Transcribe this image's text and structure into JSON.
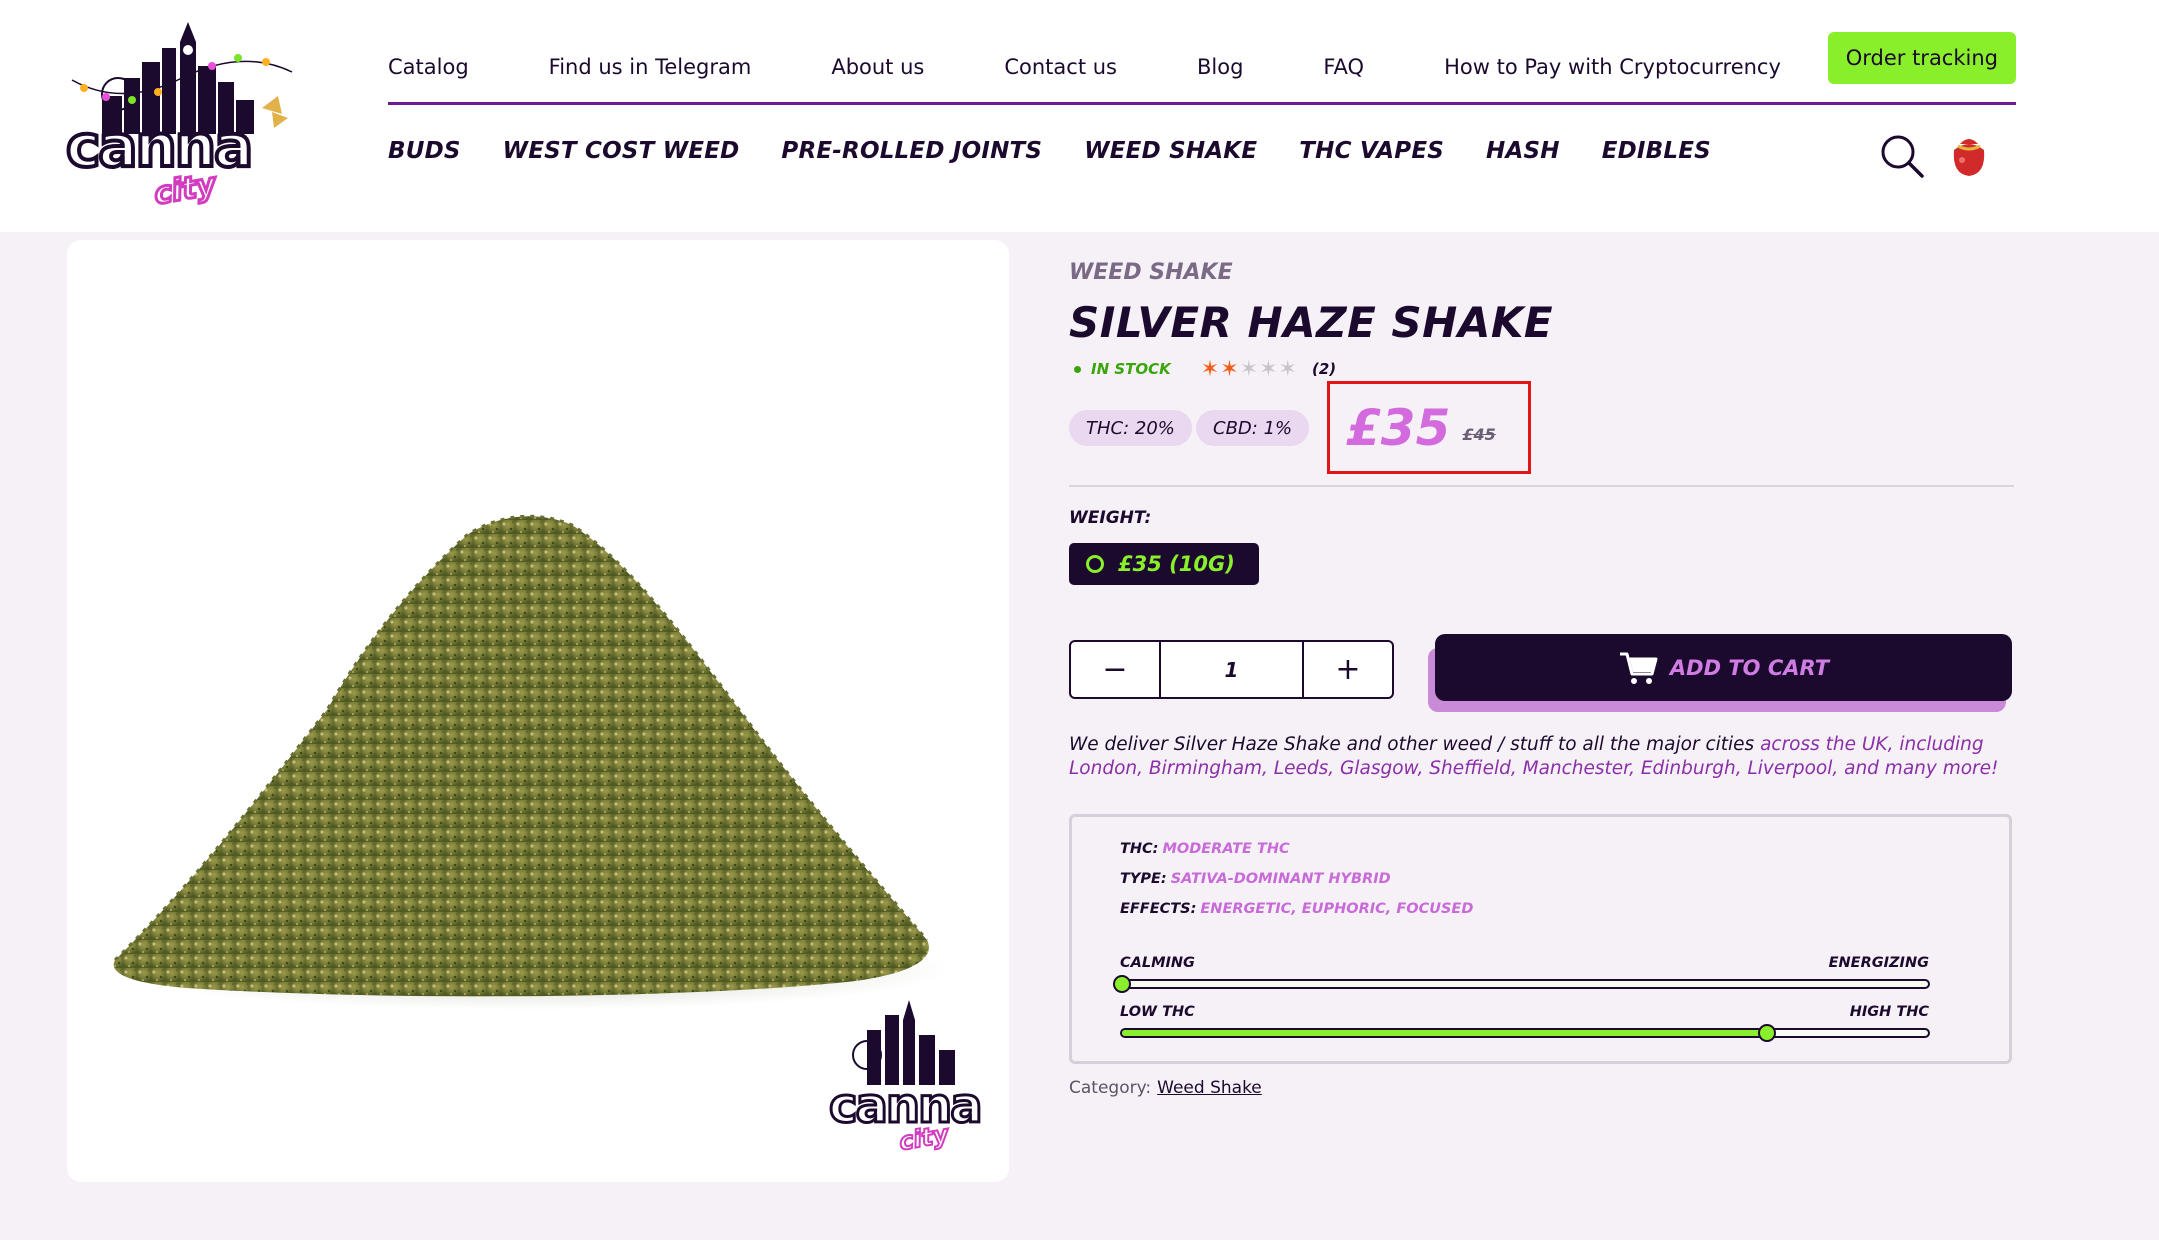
{
  "header": {
    "logo_main": "canna",
    "logo_sub": "city",
    "top_links": [
      "Catalog",
      "Find us in Telegram",
      "About us",
      "Contact us",
      "Blog",
      "FAQ",
      "How to Pay with Cryptocurrency"
    ],
    "order_tracking": "Order tracking",
    "categories": [
      "BUDS",
      "WEST COST WEED",
      "PRE-ROLLED JOINTS",
      "WEED SHAKE",
      "THC VAPES",
      "HASH",
      "EDIBLES"
    ]
  },
  "product": {
    "category": "WEED SHAKE",
    "title": "SILVER HAZE SHAKE",
    "stock": "IN STOCK",
    "rating": 2,
    "rating_max": 5,
    "review_count": "(2)",
    "thc_pill": "THC: 20%",
    "cbd_pill": "CBD: 1%",
    "price": "£35",
    "old_price": "£45",
    "weight_label": "WEIGHT:",
    "weight_option": "£35 (10G)",
    "quantity": "1",
    "minus": "−",
    "plus": "+",
    "add_to_cart": "ADD TO CART",
    "delivery_text": "We deliver Silver Haze Shake and other weed / stuff to all the major cities",
    "delivery_highlight": "across the UK, including London, Birmingham, Leeds, Glasgow, Sheffield, Manchester, Edinburgh, Liverpool, and many more!",
    "specs": {
      "thc_label": "THC:",
      "thc_value": "MODERATE THC",
      "type_label": "TYPE:",
      "type_value": "SATIVA-DOMINANT HYBRID",
      "effects_label": "EFFECTS:",
      "effects_value": "ENERGETIC, EUPHORIC, FOCUSED",
      "scale1_left": "CALMING",
      "scale1_right": "ENERGIZING",
      "scale1_value": 0.0,
      "scale2_left": "LOW THC",
      "scale2_right": "HIGH THC",
      "scale2_value": 0.8
    },
    "category_label": "Category:",
    "category_link": "Weed Shake"
  },
  "colors": {
    "brand_dark": "#1c0a2e",
    "accent_green": "#88ef2a",
    "accent_pink": "#d36ade",
    "highlight_red": "#e01616",
    "star_on": "#f35a14"
  },
  "icons": [
    "search-icon",
    "shopping-bag-icon",
    "cart-icon",
    "star-icon"
  ]
}
